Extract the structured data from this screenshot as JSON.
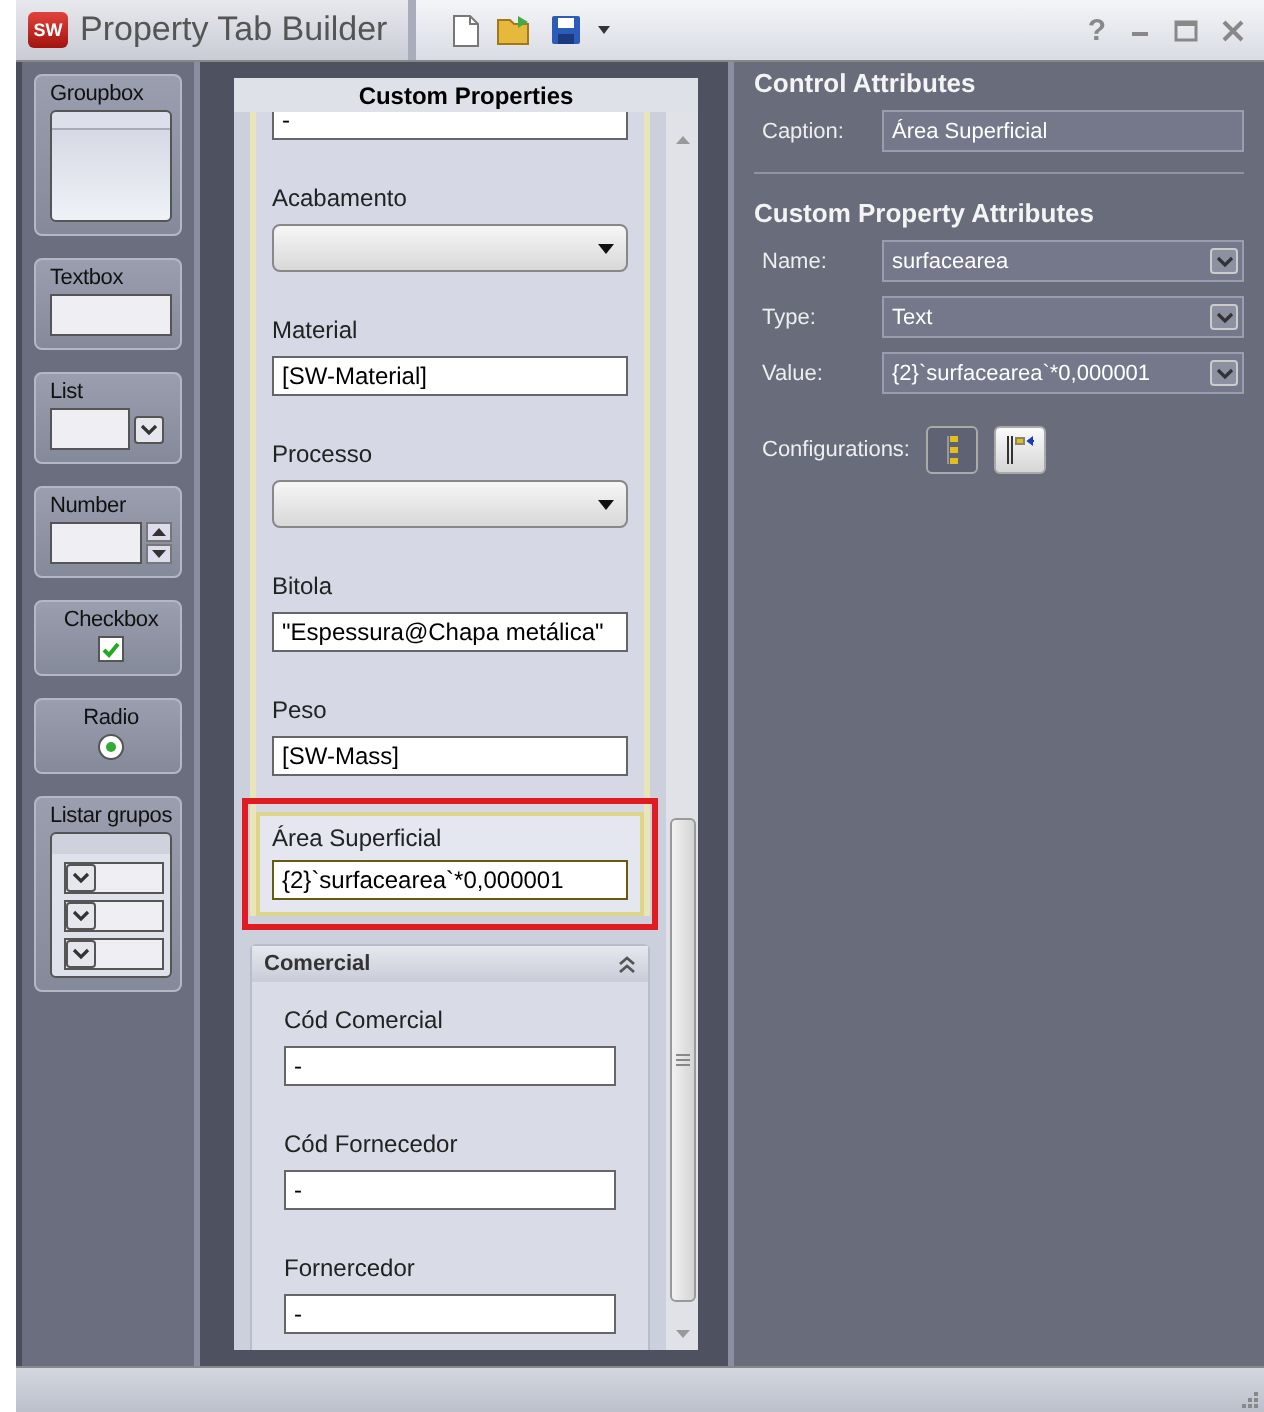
{
  "window": {
    "title": "Property Tab Builder",
    "logo_text": "SW",
    "help": "?"
  },
  "palette": [
    {
      "kind": "groupbox",
      "label": "Groupbox"
    },
    {
      "kind": "textbox",
      "label": "Textbox"
    },
    {
      "kind": "list",
      "label": "List"
    },
    {
      "kind": "number",
      "label": "Number"
    },
    {
      "kind": "checkbox",
      "label": "Checkbox",
      "checked": true
    },
    {
      "kind": "radio",
      "label": "Radio",
      "selected": true
    },
    {
      "kind": "listgroups",
      "label": "Listar grupos"
    }
  ],
  "form": {
    "title": "Custom Properties",
    "groups": [
      {
        "fields": [
          {
            "kind": "text",
            "value": "-",
            "selected": false
          },
          {
            "kind": "dropdown",
            "label": "Acabamento",
            "selected": false
          },
          {
            "kind": "text",
            "label": "Material",
            "value": "[SW-Material]",
            "selected": false
          },
          {
            "kind": "dropdown",
            "label": "Processo",
            "selected": false
          },
          {
            "kind": "text",
            "label": "Bitola",
            "value": "\"Espessura@Chapa metálica\"",
            "selected": false
          },
          {
            "kind": "text",
            "label": "Peso",
            "value": "[SW-Mass]",
            "selected": false
          },
          {
            "kind": "text",
            "label": "Área Superficial",
            "value": "{2}`surfacearea`*0,000001",
            "selected": true
          }
        ]
      },
      {
        "title": "Comercial",
        "expanded": true,
        "fields": [
          {
            "kind": "text",
            "label": "Cód Comercial",
            "value": "-",
            "selected": false
          },
          {
            "kind": "text",
            "label": "Cód Fornecedor",
            "value": "-",
            "selected": false
          },
          {
            "kind": "text",
            "label": "Fornercedor",
            "value": "-",
            "selected": false
          }
        ]
      }
    ]
  },
  "control_attributes": {
    "title": "Control Attributes",
    "caption_label": "Caption:",
    "caption": "Área Superficial"
  },
  "custom_property_attributes": {
    "title": "Custom Property Attributes",
    "rows": [
      {
        "label": "Name:",
        "value": "surfacearea"
      },
      {
        "label": "Type:",
        "value": "Text"
      },
      {
        "label": "Value:",
        "value": "{2}`surfacearea`*0,000001"
      }
    ],
    "configurations_label": "Configurations:"
  }
}
